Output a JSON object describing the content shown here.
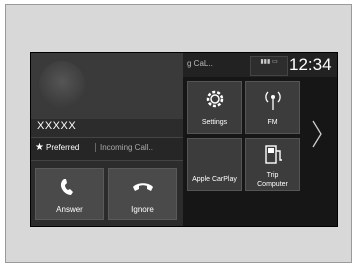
{
  "call": {
    "caller_name": "XXXXX",
    "preferred_label": "Preferred",
    "status_text": "Incoming Call..",
    "answer_label": "Answer",
    "ignore_label": "Ignore"
  },
  "home": {
    "header_text": "g CaL..",
    "clock": "12:34",
    "tiles": [
      {
        "label": "Settings",
        "icon": "gear-icon"
      },
      {
        "label": "FM",
        "icon": "radio-icon"
      },
      {
        "label": "Apple CarPlay",
        "icon": "none"
      },
      {
        "label": "Trip Computer",
        "icon": "fuel-icon"
      }
    ],
    "next_icon": "chevron-right-icon"
  },
  "colors": {
    "screen": "#0d0d0d",
    "answer_icon": "#ffffff"
  }
}
